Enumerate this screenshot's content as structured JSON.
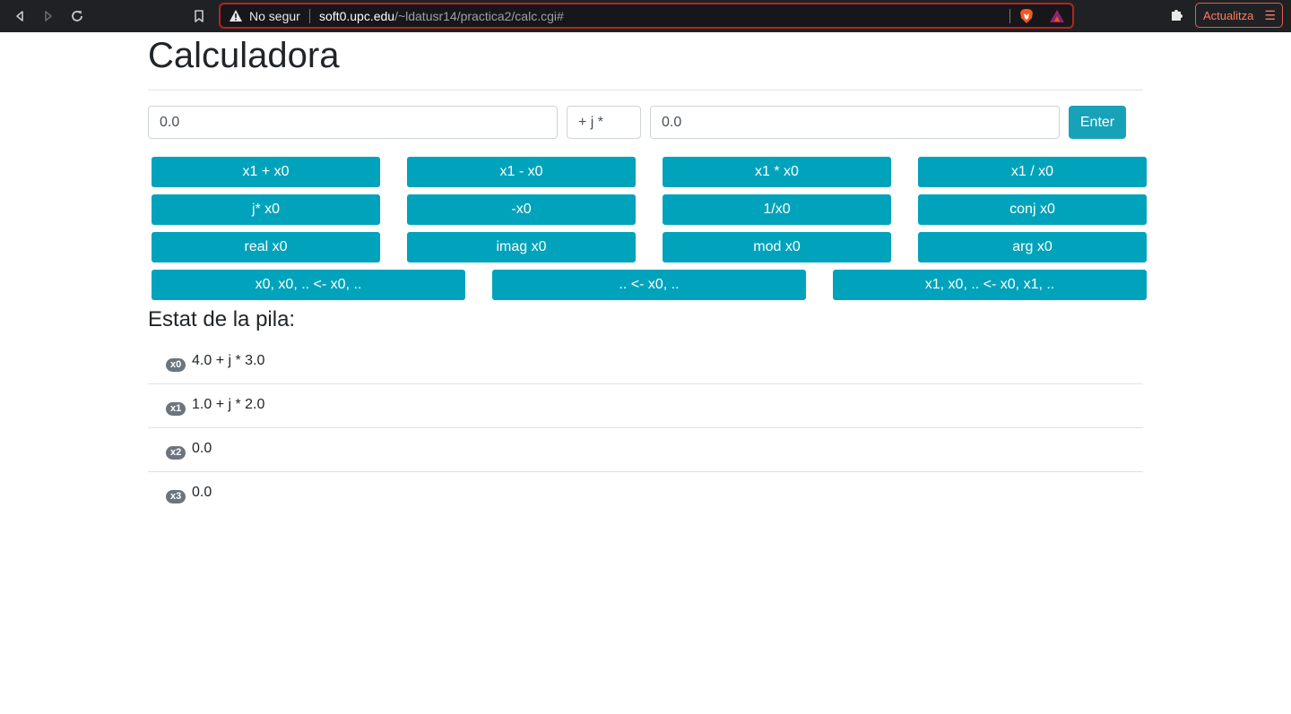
{
  "browser": {
    "security_label": "No segur",
    "url_host": "soft0.upc.edu",
    "url_path": "/~ldatusr14/practica2/calc.cgi#",
    "update_label": "Actualitza"
  },
  "page": {
    "title": "Calculadora",
    "input_real": "0.0",
    "input_separator": "+ j *",
    "input_imag": "0.0",
    "enter_label": "Enter",
    "ops_row1": [
      "x1 + x0",
      "x1 - x0",
      "x1 * x0",
      "x1 / x0"
    ],
    "ops_row2": [
      "j* x0",
      "-x0",
      "1/x0",
      "conj x0"
    ],
    "ops_row3": [
      "real x0",
      "imag x0",
      "mod x0",
      "arg x0"
    ],
    "ops_row4": [
      "x0, x0, .. <- x0, ..",
      ".. <- x0, ..",
      "x1, x0, .. <- x0, x1, .."
    ],
    "stack_title": "Estat de la pila:",
    "stack": [
      {
        "label": "x0",
        "value": "4.0 + j * 3.0"
      },
      {
        "label": "x1",
        "value": "1.0 + j * 2.0"
      },
      {
        "label": "x2",
        "value": "0.0"
      },
      {
        "label": "x3",
        "value": "0.0"
      }
    ]
  },
  "colors": {
    "button": "#00a3bb",
    "badge": "#6c757d",
    "chrome": "#202124",
    "warning_border": "#b3261e"
  }
}
